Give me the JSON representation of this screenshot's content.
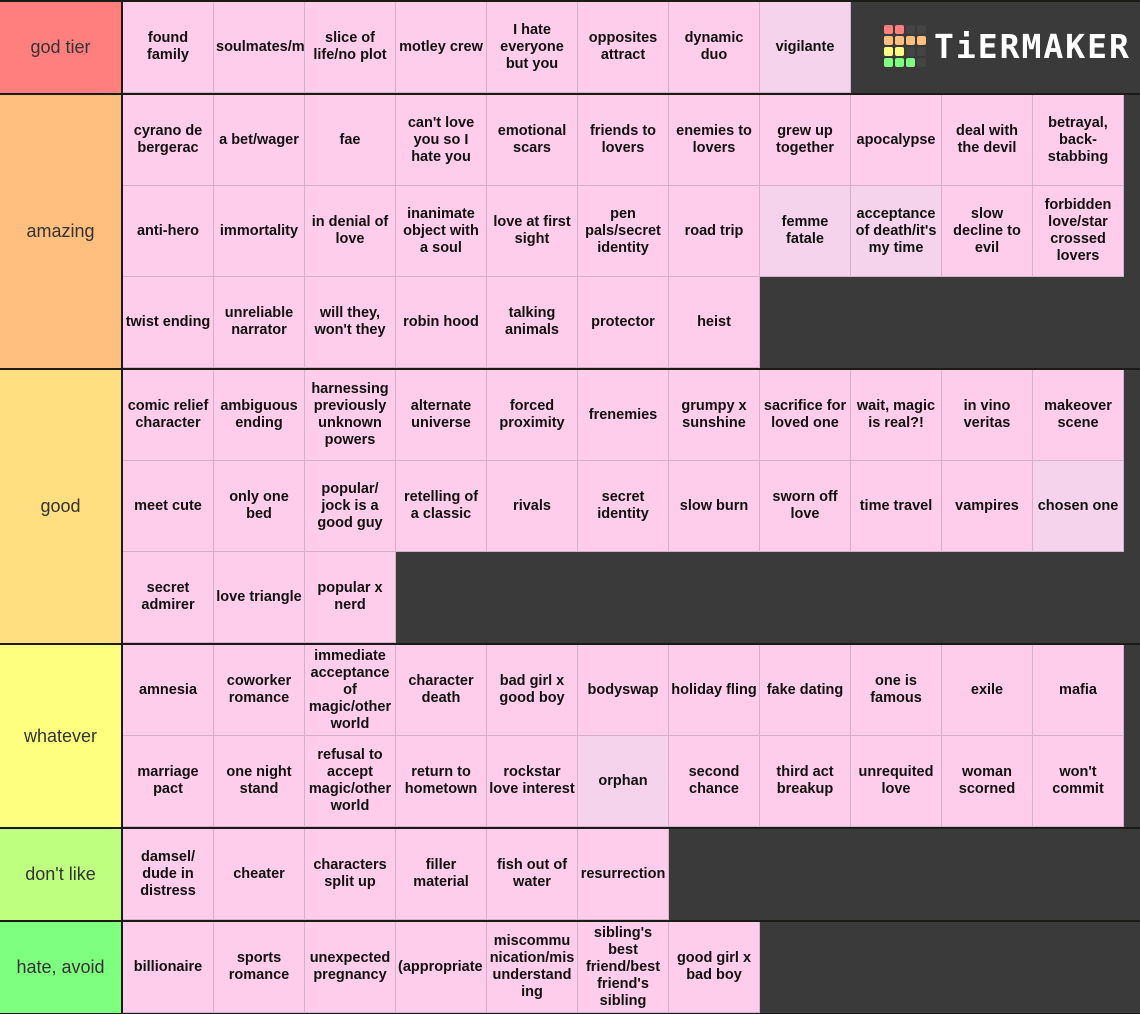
{
  "logo": {
    "text": "TiERMAKER",
    "grid": [
      [
        "#ff7f7f",
        "#ff7f7f",
        "#444",
        "#444"
      ],
      [
        "#ffbf7f",
        "#ffbf7f",
        "#ffbf7f",
        "#ffbf7f"
      ],
      [
        "#ffff7f",
        "#ffff7f",
        "#444",
        "#444"
      ],
      [
        "#7fff7f",
        "#7fff7f",
        "#7fff7f",
        "#444"
      ]
    ]
  },
  "tiers": [
    {
      "label": "god tier",
      "color": "#ff7f7f",
      "items": [
        {
          "text": "found family"
        },
        {
          "text": "soulmates/meant to be",
          "display": "soulmates/m to be",
          "clipped": true
        },
        {
          "text": "slice of life/no plot"
        },
        {
          "text": "motley crew"
        },
        {
          "text": "I hate everyone but you"
        },
        {
          "text": "opposites attract"
        },
        {
          "text": "dynamic duo"
        },
        {
          "text": "vigilante",
          "dim": true
        }
      ]
    },
    {
      "label": "amazing",
      "color": "#ffbf7f",
      "items": [
        {
          "text": "cyrano de bergerac"
        },
        {
          "text": "a bet/wager"
        },
        {
          "text": "fae"
        },
        {
          "text": "can't love you so I hate you"
        },
        {
          "text": "emotional scars"
        },
        {
          "text": "friends to lovers"
        },
        {
          "text": "enemies to lovers"
        },
        {
          "text": "grew up together"
        },
        {
          "text": "apocalypse"
        },
        {
          "text": "deal with the devil"
        },
        {
          "text": "betrayal, back-stabbing"
        },
        {
          "text": "anti-hero"
        },
        {
          "text": "immortality"
        },
        {
          "text": "in denial of love"
        },
        {
          "text": "inanimate object with a soul"
        },
        {
          "text": "love at first sight"
        },
        {
          "text": "pen pals/secret identity"
        },
        {
          "text": "road trip"
        },
        {
          "text": "femme fatale",
          "dim": true
        },
        {
          "text": "acceptance of death/it's my time",
          "dim": true
        },
        {
          "text": "slow decline to evil"
        },
        {
          "text": "forbidden love/star crossed lovers"
        },
        {
          "text": "twist ending"
        },
        {
          "text": "unreliable narrator"
        },
        {
          "text": "will they, won't they"
        },
        {
          "text": "robin hood"
        },
        {
          "text": "talking animals"
        },
        {
          "text": "protector"
        },
        {
          "text": "heist"
        }
      ]
    },
    {
      "label": "good",
      "color": "#ffdf7f",
      "items": [
        {
          "text": "comic relief character"
        },
        {
          "text": "ambiguous ending"
        },
        {
          "text": "harnessing previously unknown powers"
        },
        {
          "text": "alternate universe"
        },
        {
          "text": "forced proximity"
        },
        {
          "text": "frenemies"
        },
        {
          "text": "grumpy x sunshine"
        },
        {
          "text": "sacrifice for loved one"
        },
        {
          "text": "wait, magic is real?!"
        },
        {
          "text": "in vino veritas"
        },
        {
          "text": "makeover scene"
        },
        {
          "text": "meet cute"
        },
        {
          "text": "only one bed"
        },
        {
          "text": "popular/ jock is a good guy"
        },
        {
          "text": "retelling of a classic"
        },
        {
          "text": "rivals"
        },
        {
          "text": "secret identity"
        },
        {
          "text": "slow burn"
        },
        {
          "text": "sworn off love"
        },
        {
          "text": "time travel"
        },
        {
          "text": "vampires"
        },
        {
          "text": "chosen one",
          "dim": true
        },
        {
          "text": "secret admirer"
        },
        {
          "text": "love triangle"
        },
        {
          "text": "popular x nerd"
        }
      ]
    },
    {
      "label": "whatever",
      "color": "#ffff7f",
      "items": [
        {
          "text": "amnesia"
        },
        {
          "text": "coworker romance"
        },
        {
          "text": "immediate acceptance of magic/other world"
        },
        {
          "text": "character death"
        },
        {
          "text": "bad girl x good boy"
        },
        {
          "text": "bodyswap"
        },
        {
          "text": "holiday fling"
        },
        {
          "text": "fake dating"
        },
        {
          "text": "one is famous"
        },
        {
          "text": "exile"
        },
        {
          "text": "mafia"
        },
        {
          "text": "marriage pact"
        },
        {
          "text": "one night stand"
        },
        {
          "text": "refusal to accept magic/other world"
        },
        {
          "text": "return to hometown"
        },
        {
          "text": "rockstar love interest"
        },
        {
          "text": "orphan",
          "dim": true
        },
        {
          "text": "second chance"
        },
        {
          "text": "third act breakup"
        },
        {
          "text": "unrequited love"
        },
        {
          "text": "woman scorned"
        },
        {
          "text": "won't commit"
        }
      ]
    },
    {
      "label": "don't like",
      "color": "#bfff7f",
      "items": [
        {
          "text": "damsel/ dude in distress"
        },
        {
          "text": "cheater"
        },
        {
          "text": "characters split up"
        },
        {
          "text": "filler material"
        },
        {
          "text": "fish out of water"
        },
        {
          "text": "resurrection"
        }
      ]
    },
    {
      "label": "hate, avoid",
      "color": "#7fff7f",
      "items": [
        {
          "text": "billionaire"
        },
        {
          "text": "sports romance"
        },
        {
          "text": "unexpected pregnancy"
        },
        {
          "text": "(appropriate) age gap",
          "display": "(appropriate age gap",
          "clipped": true
        },
        {
          "text": "miscommunication/misunderstanding",
          "display": "miscommu nication/mis understand ing"
        },
        {
          "text": "sibling's best friend/best friend's sibling"
        },
        {
          "text": "good girl x bad boy"
        }
      ]
    }
  ]
}
